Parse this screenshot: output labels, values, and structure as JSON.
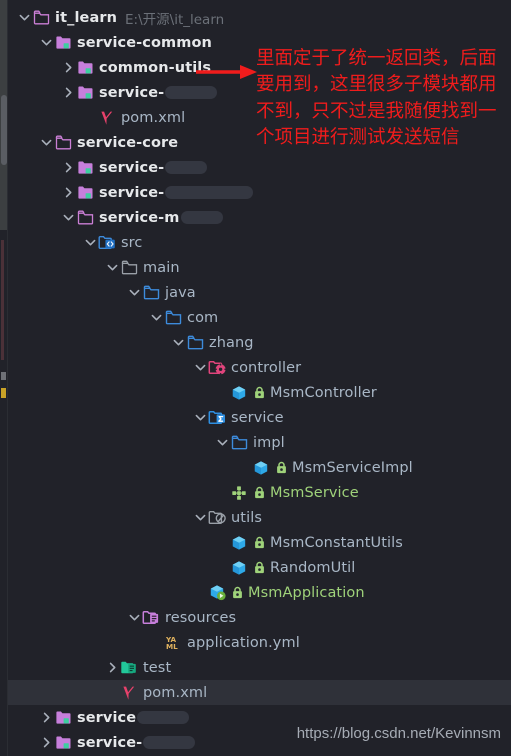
{
  "window": {
    "background": "#212229",
    "selection_color": "#2f3139",
    "accent_red": "#f01c1c"
  },
  "annotation": {
    "text": "里面定于了统一返回类，后面要用到，这里很多子模块都用不到，只不过是我随便找到一个项目进行测试发送短信",
    "color": "#f01c1c",
    "arrow_icon": "red-right-arrow"
  },
  "watermark": {
    "text": "https://blog.csdn.net/Kevinnsm"
  },
  "tree": {
    "rows": [
      {
        "label": "it_learn",
        "secondary": "E:\\开源\\it_learn",
        "icon": "folder-module-outline-pink",
        "depth": 0,
        "toggle": "expanded",
        "style": "white",
        "redacted": 0
      },
      {
        "label": "service-common",
        "secondary": "",
        "icon": "folder-maven-module",
        "depth": 1,
        "toggle": "expanded",
        "style": "white",
        "redacted": 0
      },
      {
        "label": "common-utils",
        "secondary": "",
        "icon": "folder-maven-module",
        "depth": 2,
        "toggle": "collapsed",
        "style": "white",
        "redacted": 0
      },
      {
        "label": "service-",
        "secondary": "",
        "icon": "folder-maven-module",
        "depth": 2,
        "toggle": "collapsed",
        "style": "white",
        "redacted": 52
      },
      {
        "label": "pom.xml",
        "secondary": "",
        "icon": "maven-pom",
        "depth": 3,
        "toggle": "none",
        "style": "normal",
        "redacted": 0
      },
      {
        "label": "service-core",
        "secondary": "",
        "icon": "folder-module-outline-pink",
        "depth": 1,
        "toggle": "expanded",
        "style": "white",
        "redacted": 0
      },
      {
        "label": "service-",
        "secondary": "",
        "icon": "folder-maven-module",
        "depth": 2,
        "toggle": "collapsed",
        "style": "white",
        "redacted": 42
      },
      {
        "label": "service-",
        "secondary": "",
        "icon": "folder-maven-module",
        "depth": 2,
        "toggle": "collapsed",
        "style": "white",
        "redacted": 88
      },
      {
        "label": "service-m",
        "secondary": "",
        "icon": "folder-module-outline-pink",
        "depth": 2,
        "toggle": "expanded",
        "style": "white",
        "redacted": 42
      },
      {
        "label": "src",
        "secondary": "",
        "icon": "folder-source-code",
        "depth": 3,
        "toggle": "expanded",
        "style": "normal",
        "redacted": 0
      },
      {
        "label": "main",
        "secondary": "",
        "icon": "folder-plain-gray",
        "depth": 4,
        "toggle": "expanded",
        "style": "normal",
        "redacted": 0
      },
      {
        "label": "java",
        "secondary": "",
        "icon": "folder-source-blue",
        "depth": 5,
        "toggle": "expanded",
        "style": "normal",
        "redacted": 0
      },
      {
        "label": "com",
        "secondary": "",
        "icon": "folder-source-blue",
        "depth": 6,
        "toggle": "expanded",
        "style": "normal",
        "redacted": 0
      },
      {
        "label": "zhang",
        "secondary": "",
        "icon": "folder-source-blue",
        "depth": 7,
        "toggle": "expanded",
        "style": "normal",
        "redacted": 0
      },
      {
        "label": "controller",
        "secondary": "",
        "icon": "folder-spring-controller",
        "depth": 8,
        "toggle": "expanded",
        "style": "normal",
        "redacted": 0
      },
      {
        "label": "MsmController",
        "secondary": "",
        "icon": "java-class",
        "lock": "lock-green",
        "depth": 9,
        "toggle": "none",
        "style": "normal",
        "redacted": 0
      },
      {
        "label": "service",
        "secondary": "",
        "icon": "folder-spring-service",
        "depth": 8,
        "toggle": "expanded",
        "style": "normal",
        "redacted": 0
      },
      {
        "label": "impl",
        "secondary": "",
        "icon": "folder-source-blue",
        "depth": 9,
        "toggle": "expanded",
        "style": "normal",
        "redacted": 0
      },
      {
        "label": "MsmServiceImpl",
        "secondary": "",
        "icon": "java-class",
        "lock": "lock-green",
        "depth": 10,
        "toggle": "none",
        "style": "normal",
        "redacted": 0
      },
      {
        "label": "MsmService",
        "secondary": "",
        "icon": "java-interface",
        "lock": "lock-green",
        "depth": 9,
        "toggle": "none",
        "style": "green",
        "redacted": 0
      },
      {
        "label": "utils",
        "secondary": "",
        "icon": "folder-spring-bean",
        "depth": 8,
        "toggle": "expanded",
        "style": "normal",
        "redacted": 0
      },
      {
        "label": "MsmConstantUtils",
        "secondary": "",
        "icon": "java-class",
        "lock": "lock-green",
        "depth": 9,
        "toggle": "none",
        "style": "normal",
        "redacted": 0
      },
      {
        "label": "RandomUtil",
        "secondary": "",
        "icon": "java-class",
        "lock": "lock-green",
        "depth": 9,
        "toggle": "none",
        "style": "normal",
        "redacted": 0
      },
      {
        "label": "MsmApplication",
        "secondary": "",
        "icon": "spring-boot-application",
        "lock": "lock-green",
        "depth": 8,
        "toggle": "none",
        "style": "green",
        "redacted": 0
      },
      {
        "label": "resources",
        "secondary": "",
        "icon": "folder-resources-purple",
        "depth": 5,
        "toggle": "expanded",
        "style": "normal",
        "redacted": 0
      },
      {
        "label": "application.yml",
        "secondary": "",
        "icon": "yaml-file",
        "depth": 6,
        "toggle": "none",
        "style": "normal",
        "redacted": 0
      },
      {
        "label": "test",
        "secondary": "",
        "icon": "folder-test-green",
        "depth": 4,
        "toggle": "collapsed",
        "style": "normal",
        "redacted": 0
      },
      {
        "label": "pom.xml",
        "secondary": "",
        "icon": "maven-pom",
        "depth": 4,
        "toggle": "none",
        "style": "normal",
        "selected": true,
        "redacted": 0
      },
      {
        "label": "service",
        "secondary": "",
        "icon": "folder-maven-module",
        "depth": 1,
        "toggle": "collapsed",
        "style": "white",
        "redacted": 52
      },
      {
        "label": "service-",
        "secondary": "",
        "icon": "folder-maven-module",
        "depth": 1,
        "toggle": "collapsed",
        "style": "white",
        "redacted": 52
      }
    ]
  }
}
